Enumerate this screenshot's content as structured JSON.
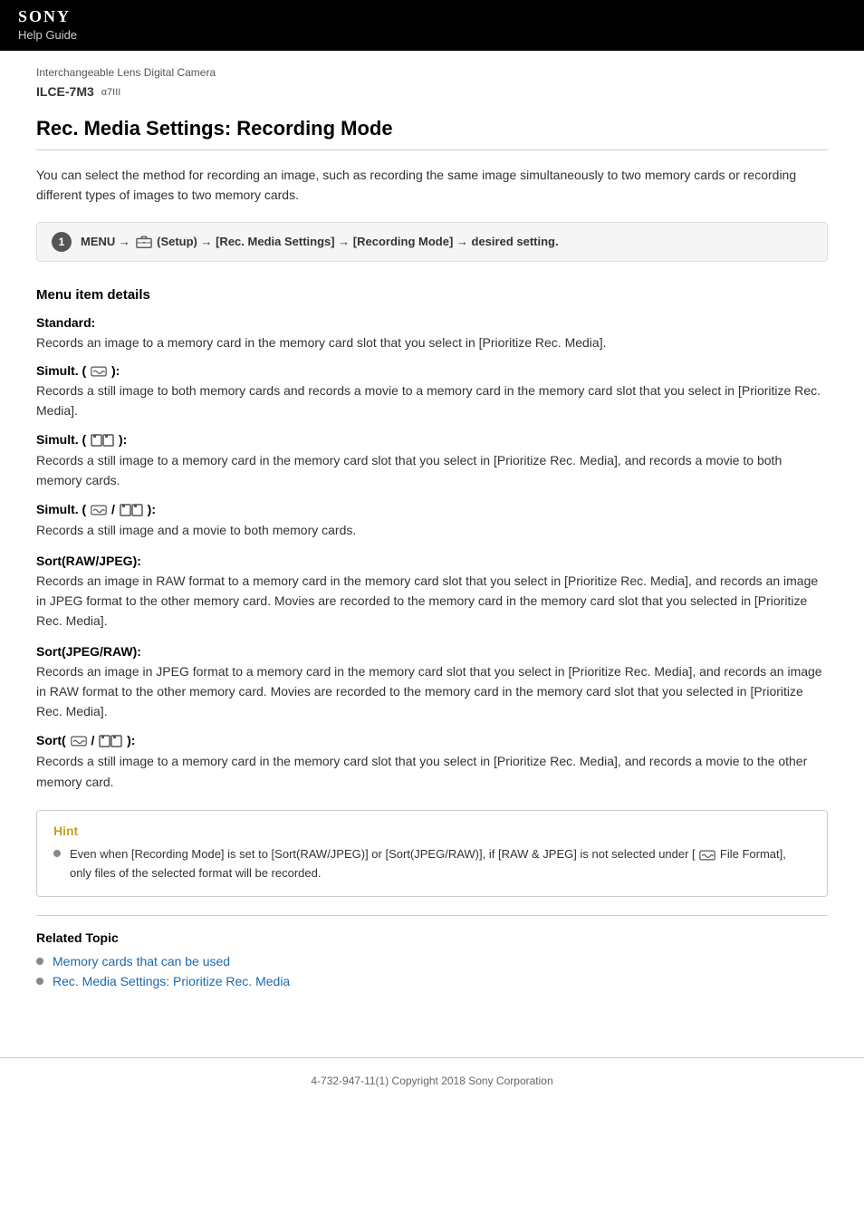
{
  "header": {
    "brand": "SONY",
    "subtitle": "Help Guide"
  },
  "breadcrumb": {
    "line1": "Interchangeable Lens Digital Camera",
    "line2_main": "ILCE-7M3",
    "line2_sub": "α7III"
  },
  "page": {
    "title": "Rec. Media Settings: Recording Mode",
    "intro": "You can select the method for recording an image, such as recording the same image simultaneously to two memory cards or recording different types of images to two memory cards."
  },
  "step": {
    "number": "1",
    "text": "MENU → ■ (Setup) → [Rec. Media Settings] → [Recording Mode] → desired setting."
  },
  "menu_details": {
    "heading": "Menu item details",
    "items": [
      {
        "label": "Standard:",
        "desc": "Records an image to a memory card in the memory card slot that you select in [Prioritize Rec. Media]."
      },
      {
        "label_prefix": "Simult. (",
        "label_icon": "wave",
        "label_suffix": "):",
        "desc": "Records a still image to both memory cards and records a movie to a memory card in the memory card slot that you select in [Prioritize Rec. Media]."
      },
      {
        "label_prefix": "Simult. (",
        "label_icon": "card",
        "label_suffix": "):",
        "desc": "Records a still image to a memory card in the memory card slot that you select in [Prioritize Rec. Media], and records a movie to both memory cards."
      },
      {
        "label_prefix": "Simult. (",
        "label_icon": "wave-card",
        "label_suffix": "):",
        "desc": "Records a still image and a movie to both memory cards."
      },
      {
        "label": "Sort(RAW/JPEG):",
        "desc": "Records an image in RAW format to a memory card in the memory card slot that you select in [Prioritize Rec. Media], and records an image in JPEG format to the other memory card. Movies are recorded to the memory card in the memory card slot that you selected in [Prioritize Rec. Media]."
      },
      {
        "label": "Sort(JPEG/RAW):",
        "desc": "Records an image in JPEG format to a memory card in the memory card slot that you select in [Prioritize Rec. Media], and records an image in RAW format to the other memory card. Movies are recorded to the memory card in the memory card slot that you selected in [Prioritize Rec. Media]."
      },
      {
        "label_prefix": "Sort(",
        "label_icon": "wave-card",
        "label_suffix": "):",
        "desc": "Records a still image to a memory card in the memory card slot that you select in [Prioritize Rec. Media], and records a movie to the other memory card."
      }
    ]
  },
  "hint": {
    "title": "Hint",
    "items": [
      "Even when [Recording Mode] is set to [Sort(RAW/JPEG)] or [Sort(JPEG/RAW)], if [RAW & JPEG] is not selected under [ ∼ File Format], only files of the selected format will be recorded."
    ]
  },
  "related": {
    "title": "Related Topic",
    "items": [
      "Memory cards that can be used",
      "Rec. Media Settings: Prioritize Rec. Media"
    ]
  },
  "footer": {
    "text": "4-732-947-11(1) Copyright 2018 Sony Corporation"
  }
}
